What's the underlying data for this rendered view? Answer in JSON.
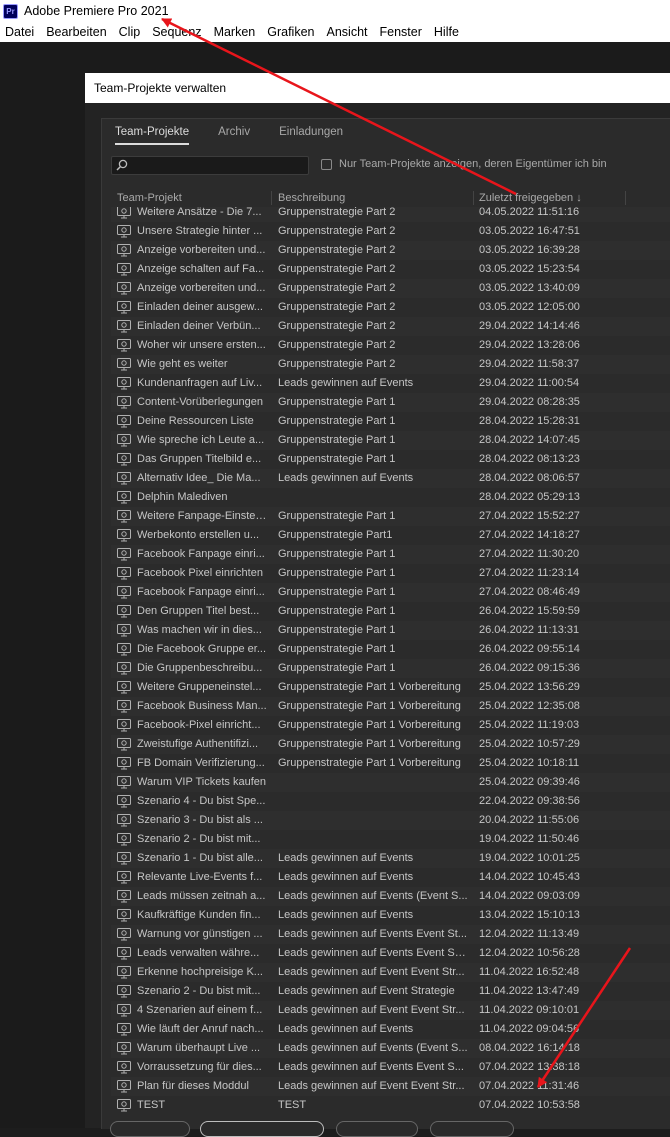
{
  "app": {
    "icon_text": "Pr",
    "title": "Adobe Premiere Pro 2021",
    "menu": [
      "Datei",
      "Bearbeiten",
      "Clip",
      "Sequenz",
      "Marken",
      "Grafiken",
      "Ansicht",
      "Fenster",
      "Hilfe"
    ]
  },
  "dialog": {
    "title": "Team-Projekte verwalten",
    "tabs": [
      {
        "label": "Team-Projekte",
        "active": true
      },
      {
        "label": "Archiv",
        "active": false
      },
      {
        "label": "Einladungen",
        "active": false
      }
    ],
    "search": {
      "placeholder": "",
      "value": ""
    },
    "owner_filter": {
      "label": "Nur Team-Projekte anzeigen, deren Eigentümer ich bin",
      "checked": false
    },
    "columns": {
      "name": "Team-Projekt",
      "description": "Beschreibung",
      "date": "Zuletzt freigegeben",
      "sort_indicator": "↓"
    },
    "rows": [
      {
        "name": "Weitere Ansätze - Die 7...",
        "desc": "Gruppenstrategie Part 2",
        "date": "04.05.2022 11:51:16"
      },
      {
        "name": "Unsere Strategie hinter ...",
        "desc": "Gruppenstrategie Part 2",
        "date": "03.05.2022 16:47:51"
      },
      {
        "name": "Anzeige vorbereiten und...",
        "desc": "Gruppenstrategie Part 2",
        "date": "03.05.2022 16:39:28"
      },
      {
        "name": "Anzeige schalten auf Fa...",
        "desc": "Gruppenstrategie Part 2",
        "date": "03.05.2022 15:23:54"
      },
      {
        "name": "Anzeige vorbereiten und...",
        "desc": "Gruppenstrategie Part 2",
        "date": "03.05.2022 13:40:09"
      },
      {
        "name": "Einladen deiner ausgew...",
        "desc": "Gruppenstrategie Part 2",
        "date": "03.05.2022 12:05:00"
      },
      {
        "name": "Einladen deiner Verbün...",
        "desc": "Gruppenstrategie Part 2",
        "date": "29.04.2022 14:14:46"
      },
      {
        "name": "Woher wir unsere ersten...",
        "desc": "Gruppenstrategie Part 2",
        "date": "29.04.2022 13:28:06"
      },
      {
        "name": "Wie geht es weiter",
        "desc": "Gruppenstrategie Part 2",
        "date": "29.04.2022 11:58:37"
      },
      {
        "name": "Kundenanfragen auf Liv...",
        "desc": "Leads gewinnen auf Events",
        "date": "29.04.2022 11:00:54"
      },
      {
        "name": "Content-Vorüberlegungen",
        "desc": "Gruppenstrategie Part 1",
        "date": "29.04.2022 08:28:35"
      },
      {
        "name": "Deine Ressourcen Liste",
        "desc": "Gruppenstrategie Part 1",
        "date": "28.04.2022 15:28:31"
      },
      {
        "name": "Wie spreche ich Leute a...",
        "desc": "Gruppenstrategie Part 1",
        "date": "28.04.2022 14:07:45"
      },
      {
        "name": "Das Gruppen Titelbild e...",
        "desc": "Gruppenstrategie Part 1",
        "date": "28.04.2022 08:13:23"
      },
      {
        "name": "Alternativ Idee_ Die Ma...",
        "desc": "Leads gewinnen auf Events",
        "date": "28.04.2022 08:06:57"
      },
      {
        "name": "Delphin Malediven",
        "desc": "",
        "date": "28.04.2022 05:29:13"
      },
      {
        "name": "Weitere Fanpage-Einstel...",
        "desc": "Gruppenstrategie Part 1",
        "date": "27.04.2022 15:52:27"
      },
      {
        "name": "Werbekonto erstellen u...",
        "desc": "Gruppenstrategie Part1",
        "date": "27.04.2022 14:18:27"
      },
      {
        "name": "Facebook Fanpage einri...",
        "desc": "Gruppenstrategie Part 1",
        "date": "27.04.2022 11:30:20"
      },
      {
        "name": "Facebook Pixel einrichten",
        "desc": "Gruppenstrategie Part 1",
        "date": "27.04.2022 11:23:14"
      },
      {
        "name": "Facebook Fanpage einri...",
        "desc": "Gruppenstrategie Part 1",
        "date": "27.04.2022 08:46:49"
      },
      {
        "name": "Den Gruppen Titel best...",
        "desc": "Gruppenstrategie Part 1",
        "date": "26.04.2022 15:59:59"
      },
      {
        "name": "Was machen wir in dies...",
        "desc": "Gruppenstrategie Part 1",
        "date": "26.04.2022 11:13:31"
      },
      {
        "name": "Die Facebook Gruppe er...",
        "desc": "Gruppenstrategie Part 1",
        "date": "26.04.2022 09:55:14"
      },
      {
        "name": "Die Gruppenbeschreibu...",
        "desc": "Gruppenstrategie Part 1",
        "date": "26.04.2022 09:15:36"
      },
      {
        "name": "Weitere Gruppeneinstel...",
        "desc": "Gruppenstrategie Part 1 Vorbereitung",
        "date": "25.04.2022 13:56:29"
      },
      {
        "name": "Facebook Business Man...",
        "desc": "Gruppenstrategie Part 1 Vorbereitung",
        "date": "25.04.2022 12:35:08"
      },
      {
        "name": "Facebook-Pixel einricht...",
        "desc": "Gruppenstrategie Part 1 Vorbereitung",
        "date": "25.04.2022 11:19:03"
      },
      {
        "name": "Zweistufige Authentifizi...",
        "desc": "Gruppenstrategie Part 1 Vorbereitung",
        "date": "25.04.2022 10:57:29"
      },
      {
        "name": "FB Domain Verifizierung...",
        "desc": "Gruppenstrategie Part 1 Vorbereitung",
        "date": "25.04.2022 10:18:11"
      },
      {
        "name": "Warum VIP Tickets kaufen",
        "desc": "",
        "date": "25.04.2022 09:39:46"
      },
      {
        "name": "Szenario 4 - Du bist Spe...",
        "desc": "",
        "date": "22.04.2022 09:38:56"
      },
      {
        "name": "Szenario 3 - Du bist als ...",
        "desc": "",
        "date": "20.04.2022 11:55:06"
      },
      {
        "name": "Szenario 2 - Du bist mit...",
        "desc": "",
        "date": "19.04.2022 11:50:46"
      },
      {
        "name": "Szenario 1 - Du bist alle...",
        "desc": "Leads gewinnen auf Events",
        "date": "19.04.2022 10:01:25"
      },
      {
        "name": "Relevante Live-Events f...",
        "desc": "Leads gewinnen auf Events",
        "date": "14.04.2022 10:45:43"
      },
      {
        "name": "Leads müssen zeitnah a...",
        "desc": "Leads gewinnen auf Events (Event S...",
        "date": "14.04.2022 09:03:09"
      },
      {
        "name": "Kaufkräftige Kunden fin...",
        "desc": "Leads gewinnen auf Events",
        "date": "13.04.2022 15:10:13"
      },
      {
        "name": "Warnung vor günstigen ...",
        "desc": "Leads gewinnen auf Events Event St...",
        "date": "12.04.2022 11:13:49"
      },
      {
        "name": "Leads verwalten währe...",
        "desc": "Leads gewinnen auf Events Event Str...",
        "date": "12.04.2022 10:56:28"
      },
      {
        "name": "Erkenne hochpreisige K...",
        "desc": "Leads gewinnen auf Event Event Str...",
        "date": "11.04.2022 16:52:48"
      },
      {
        "name": "Szenario 2 - Du bist mit...",
        "desc": "Leads gewinnen auf Event Strategie",
        "date": "11.04.2022 13:47:49"
      },
      {
        "name": "4 Szenarien auf einem f...",
        "desc": "Leads gewinnen auf Event Event Str...",
        "date": "11.04.2022 09:10:01"
      },
      {
        "name": "Wie läuft der Anruf nach...",
        "desc": "Leads gewinnen auf Events",
        "date": "11.04.2022 09:04:56"
      },
      {
        "name": "Warum überhaupt Live ...",
        "desc": "Leads gewinnen auf Events (Event S...",
        "date": "08.04.2022 16:14:18"
      },
      {
        "name": "Vorraussetzung für dies...",
        "desc": "Leads gewinnen auf Events Event S...",
        "date": "07.04.2022 13:38:18"
      },
      {
        "name": "Plan für dieses Moddul",
        "desc": "Leads gewinnen auf Event Event Str...",
        "date": "07.04.2022 11:31:46"
      },
      {
        "name": "TEST",
        "desc": "TEST",
        "date": "07.04.2022 10:53:58"
      }
    ]
  },
  "annotation": {
    "color": "#e8151b"
  }
}
